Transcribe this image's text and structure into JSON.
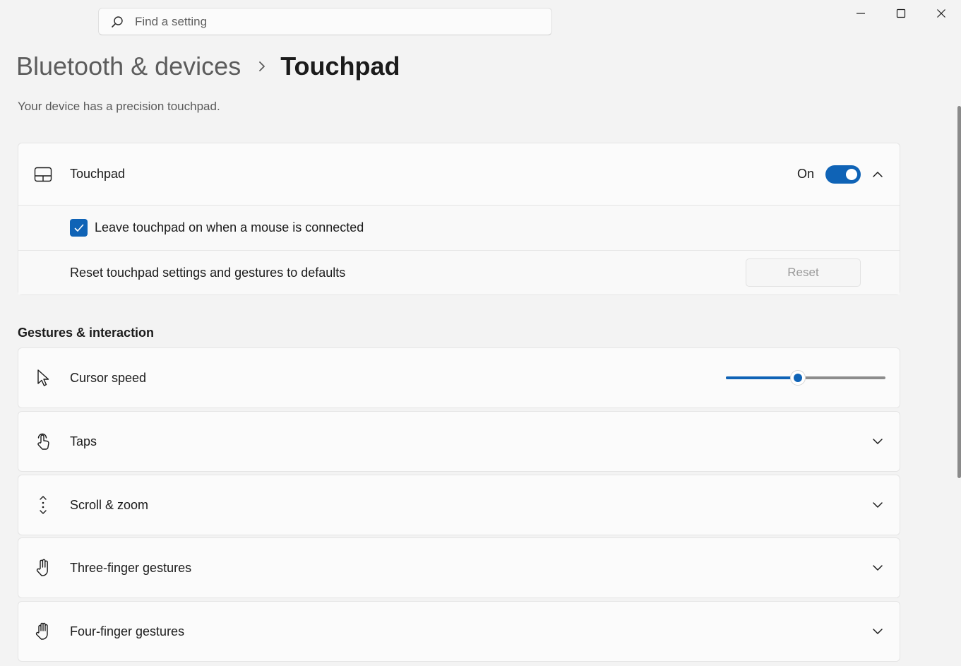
{
  "search": {
    "placeholder": "Find a setting"
  },
  "breadcrumb": {
    "parent": "Bluetooth & devices",
    "current": "Touchpad"
  },
  "subtitle": "Your device has a precision touchpad.",
  "touchpad_group": {
    "label": "Touchpad",
    "toggle_state": "On",
    "toggle_on": true,
    "leave_on_label": "Leave touchpad on when a mouse is connected",
    "leave_on_checked": true,
    "reset_label": "Reset touchpad settings and gestures to defaults",
    "reset_button": "Reset"
  },
  "gestures": {
    "title": "Gestures & interaction",
    "cursor_speed": {
      "label": "Cursor speed",
      "value_fraction": 0.45
    },
    "items": [
      {
        "label": "Taps",
        "icon": "tap-icon"
      },
      {
        "label": "Scroll & zoom",
        "icon": "scroll-icon"
      },
      {
        "label": "Three-finger gestures",
        "icon": "three-finger-icon"
      },
      {
        "label": "Four-finger gestures",
        "icon": "four-finger-icon"
      }
    ]
  },
  "colors": {
    "accent": "#0f63b6",
    "background": "#f3f3f3",
    "card": "#fbfbfb"
  }
}
